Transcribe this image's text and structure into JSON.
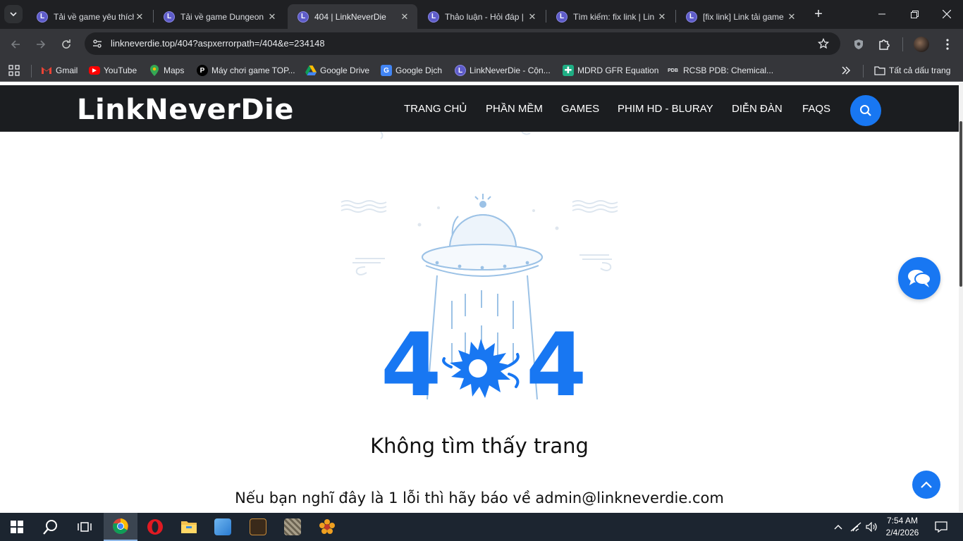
{
  "browser": {
    "tabs": [
      {
        "title": "Tải về game yêu thích",
        "favicon": "L"
      },
      {
        "title": "Tải về game Dungeon",
        "favicon": "L"
      },
      {
        "title": "404 | LinkNeverDie",
        "favicon": "L"
      },
      {
        "title": "Thảo luận - Hỏi đáp |",
        "favicon": "L"
      },
      {
        "title": "Tìm kiếm: fix link | Lin",
        "favicon": "L"
      },
      {
        "title": "[fix link] Link tải game",
        "favicon": "L"
      }
    ],
    "active_tab_index": 2,
    "url": "linkneverdie.top/404?aspxerrorpath=/404&e=234148",
    "bookmarks": [
      {
        "label": "Gmail",
        "icon": "gmail-icon"
      },
      {
        "label": "YouTube",
        "icon": "youtube-icon"
      },
      {
        "label": "Maps",
        "icon": "maps-icon"
      },
      {
        "label": "Máy chơi game TOP...",
        "icon": "p-icon"
      },
      {
        "label": "Google Drive",
        "icon": "drive-icon"
      },
      {
        "label": "Google Dịch",
        "icon": "translate-icon"
      },
      {
        "label": "LinkNeverDie - Cộn...",
        "icon": "lnd-icon"
      },
      {
        "label": "MDRD GFR Equation",
        "icon": "plus-icon"
      },
      {
        "label": "RCSB PDB: Chemical...",
        "icon": "pdb-icon"
      }
    ],
    "all_bookmarks_label": "Tất cả dấu trang",
    "pdb_icon_text": "PDB"
  },
  "site": {
    "logo": "LinkNeverDie",
    "nav": [
      "TRANG CHỦ",
      "PHẦN MỀM",
      "GAMES",
      "PHIM HD - BLURAY",
      "DIỄN ĐÀN",
      "FAQS"
    ]
  },
  "error": {
    "code_left": "4",
    "code_right": "4",
    "title": "Không tìm thấy trang",
    "message": "Nếu bạn nghĩ đây là 1 lỗi thì hãy báo về admin@linkneverdie.com"
  },
  "taskbar": {
    "time": "7:54 AM",
    "date": "2/4/2026"
  },
  "colors": {
    "accent": "#1877f2",
    "header_bg": "#1b1d20",
    "chrome_bg": "#35363a"
  }
}
